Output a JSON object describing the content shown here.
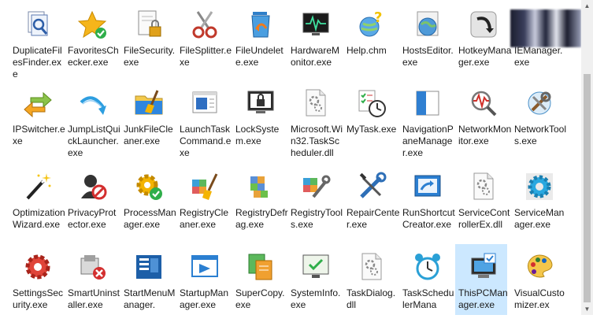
{
  "colors": {
    "selection": "#cce8ff",
    "text": "#1a1a1a"
  },
  "rows": [
    [
      {
        "name": "DuplicateFilesFinder.exe",
        "label": "DuplicateF ilesFinder. exe",
        "icon": "document-magnifier-icon"
      },
      {
        "name": "FavoritesChecker.exe",
        "label": "FavoritesC hecker.exe",
        "icon": "star-check-icon"
      },
      {
        "name": "FileSecurity.exe",
        "label": "FileSecurit y.exe",
        "icon": "file-lock-icon"
      },
      {
        "name": "FileSplitter.exe",
        "label": "FileSplitter .exe",
        "icon": "scissors-icon"
      },
      {
        "name": "FileUndelete.exe",
        "label": "FileUndele te.exe",
        "icon": "recycle-bin-icon"
      },
      {
        "name": "HardwareMonitor.exe",
        "label": "Hardware Monitor.e xe",
        "icon": "monitor-pulse-icon"
      },
      {
        "name": "Help.chm",
        "label": "Help.chm",
        "icon": "help-globe-icon"
      },
      {
        "name": "HostsEditor.exe",
        "label": "HostsEdit or.exe",
        "icon": "globe-icon"
      },
      {
        "name": "HotkeyManager.exe",
        "label": "HotkeyMa nager.exe",
        "icon": "hotkey-arrow-icon"
      },
      {
        "name": "IEManager.exe",
        "label": "IEManage r.exe",
        "icon": "blurred-icon"
      }
    ],
    [
      {
        "name": "IPSwitcher.exe",
        "label": "IPSwitcher. exe",
        "icon": "switch-arrows-icon"
      },
      {
        "name": "JumpListQuickLauncher.exe",
        "label": "JumpListQ uickLaunc her.exe",
        "icon": "jump-arrow-icon"
      },
      {
        "name": "JunkFileCleaner.exe",
        "label": "JunkFileCl eaner.exe",
        "icon": "folder-broom-icon"
      },
      {
        "name": "LaunchTaskCommand.exe",
        "label": "LaunchTas kCommand .exe",
        "icon": "window-icon"
      },
      {
        "name": "LockSystem.exe",
        "label": "LockSyste m.exe",
        "icon": "monitor-lock-icon"
      },
      {
        "name": "Microsoft.Win32.TaskScheduler.dll",
        "label": "Microsoft. Win32.Tas kSchedule r.dll",
        "icon": "dll-file-icon"
      },
      {
        "name": "MyTask.exe",
        "label": "MyTask.ex e",
        "icon": "checklist-clock-icon"
      },
      {
        "name": "NavigationPaneManager.exe",
        "label": "Navigatio nPaneMan ager.exe",
        "icon": "pane-icon"
      },
      {
        "name": "NetworkMonitor.exe",
        "label": "NetworkM onitor.exe",
        "icon": "network-magnifier-icon"
      },
      {
        "name": "NetworkTools.exe",
        "label": "NetworkT ools.exe",
        "icon": "network-tools-icon"
      }
    ],
    [
      {
        "name": "OptimizationWizard.exe",
        "label": "Optimizati onWizard. exe",
        "icon": "magic-wand-icon"
      },
      {
        "name": "PrivacyProtector.exe",
        "label": "PrivacyPro tector.exe",
        "icon": "privacy-person-icon"
      },
      {
        "name": "ProcessManager.exe",
        "label": "ProcessM anager.ex e",
        "icon": "gear-check-icon"
      },
      {
        "name": "RegistryCleaner.exe",
        "label": "RegistryCl eaner.exe",
        "icon": "registry-broom-icon"
      },
      {
        "name": "RegistryDefrag.exe",
        "label": "RegistryD efrag.exe",
        "icon": "registry-defrag-icon"
      },
      {
        "name": "RegistryTools.exe",
        "label": "RegistryTo ols.exe",
        "icon": "registry-tools-icon"
      },
      {
        "name": "RepairCenter.exe",
        "label": "RepairCen ter.exe",
        "icon": "wrench-screwdriver-icon"
      },
      {
        "name": "RunShortcutCreator.exe",
        "label": "RunShortc utCreator. exe",
        "icon": "shortcut-window-icon"
      },
      {
        "name": "ServiceControllerEx.dll",
        "label": "ServiceCo ntrollerEx. dll",
        "icon": "dll-file-icon"
      },
      {
        "name": "ServiceManager.exe",
        "label": "ServiceMa nager.exe",
        "icon": "service-gear-icon"
      }
    ],
    [
      {
        "name": "SettingsSecurity.exe",
        "label": "SettingsSe curity.exe",
        "icon": "red-gear-icon"
      },
      {
        "name": "SmartUninstaller.exe",
        "label": "SmartUnin staller.exe",
        "icon": "uninstall-box-icon"
      },
      {
        "name": "StartMenuManager.exe",
        "label": "StartMenu Manager.",
        "icon": "start-menu-icon"
      },
      {
        "name": "StartupManager.exe",
        "label": "StartupMa nager.exe",
        "icon": "startup-window-icon"
      },
      {
        "name": "SuperCopy.exe",
        "label": "SuperCop y.exe",
        "icon": "copy-documents-icon"
      },
      {
        "name": "SystemInfo.exe",
        "label": "SystemInf o.exe",
        "icon": "monitor-check-icon"
      },
      {
        "name": "TaskDialog.dll",
        "label": "TaskDialo g.dll",
        "icon": "dll-file-icon"
      },
      {
        "name": "TaskSchedulerManager.exe",
        "label": "TaskSched ulerMana",
        "icon": "alarm-clock-icon"
      },
      {
        "name": "ThisPCManager.exe",
        "label": "ThisPCMa nager.exe",
        "icon": "computer-check-icon",
        "selected": true
      },
      {
        "name": "VisualCustomizer.exe",
        "label": "VisualCust omizer.ex",
        "icon": "palette-icon"
      }
    ]
  ]
}
